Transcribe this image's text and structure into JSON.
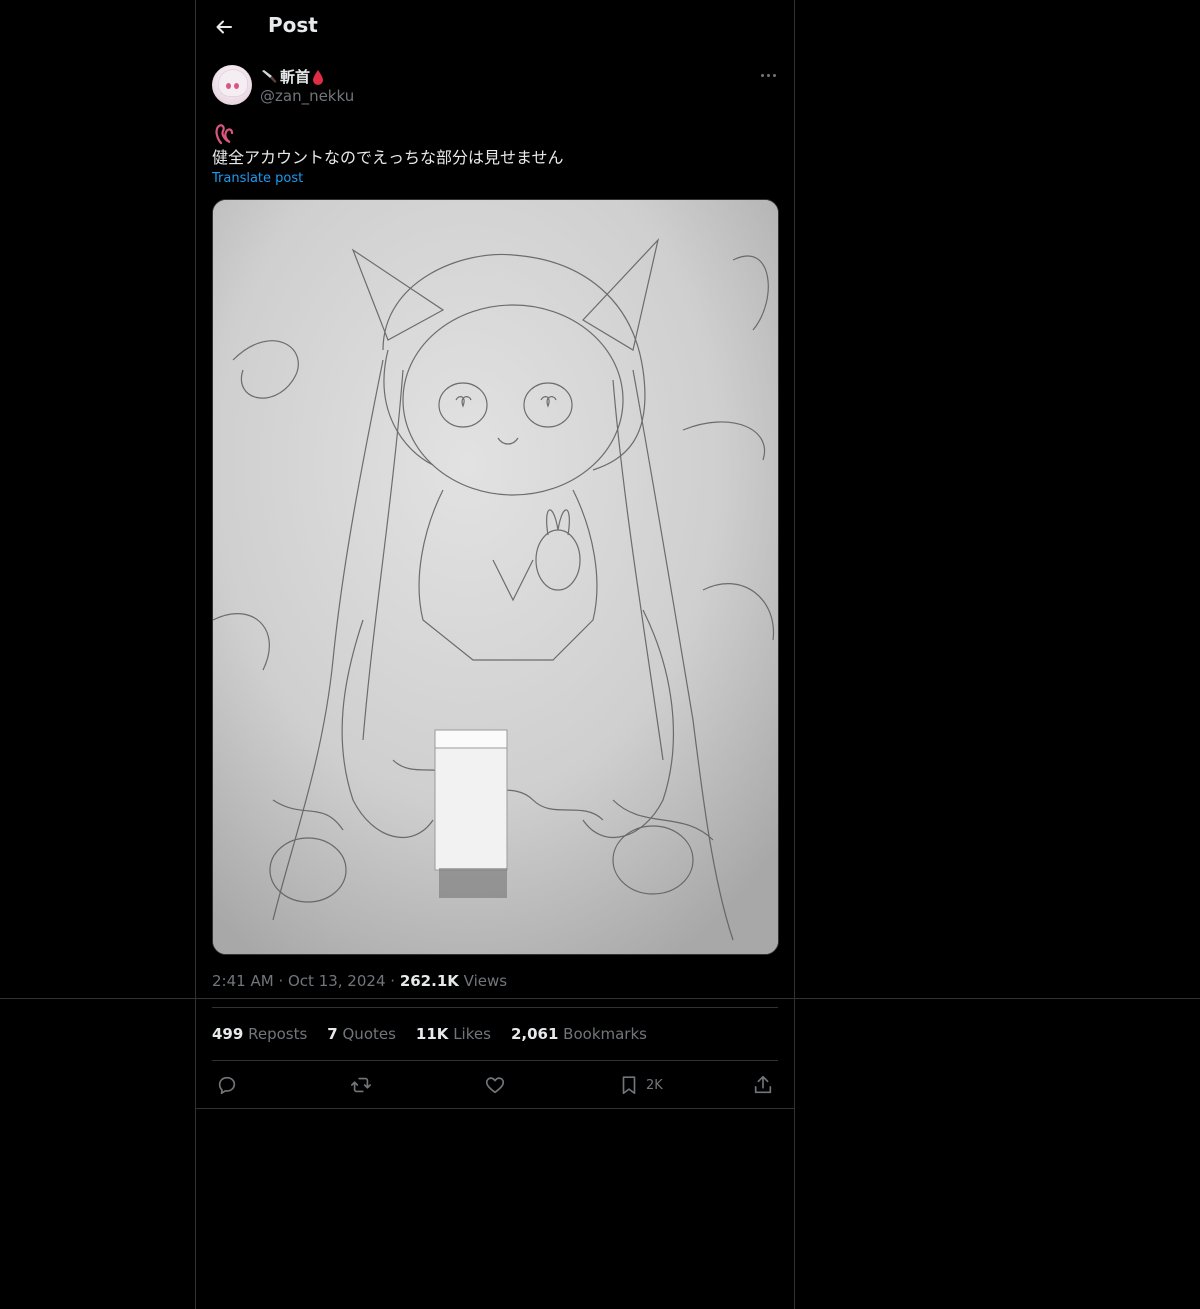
{
  "header": {
    "title": "Post"
  },
  "author": {
    "display_name": "斬首",
    "handle": "@zan_nekku"
  },
  "post": {
    "emoji": "ଓ",
    "text": "健全アカウントなのでえっちな部分は見せません",
    "translate_label": "Translate post",
    "time": "2:41 AM",
    "date": "Oct 13, 2024",
    "views_count": "262.1K",
    "views_label": "Views"
  },
  "stats": [
    {
      "count": "499",
      "label": "Reposts"
    },
    {
      "count": "7",
      "label": "Quotes"
    },
    {
      "count": "11K",
      "label": "Likes"
    },
    {
      "count": "2,061",
      "label": "Bookmarks"
    }
  ],
  "actions": {
    "reply_icon": "reply-icon",
    "repost_icon": "repost-icon",
    "like_icon": "heart-icon",
    "bookmark_icon": "bookmark-icon",
    "bookmark_count": "2K",
    "share_icon": "share-icon"
  },
  "colors": {
    "background": "#000000",
    "text": "#e7e9ea",
    "muted": "#71767b",
    "link": "#1d9bf0",
    "border": "#2f3336",
    "emoji": "#d9577f"
  }
}
